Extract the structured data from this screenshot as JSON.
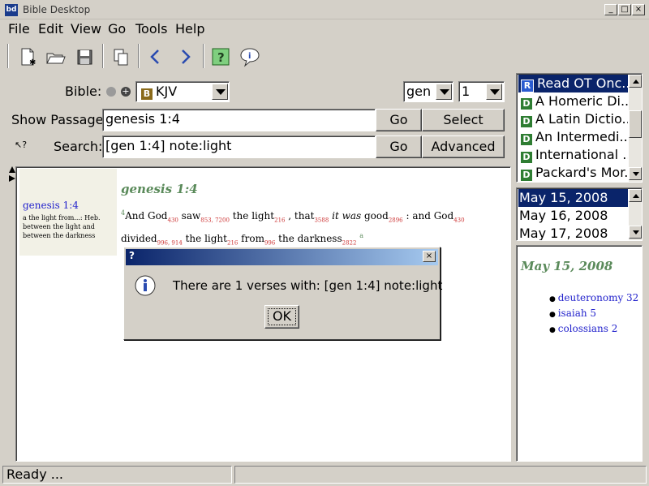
{
  "window": {
    "title": "Bible Desktop",
    "app_icon": "bd",
    "min_glyph": "_",
    "max_glyph": "□",
    "close_glyph": "×"
  },
  "menu": {
    "items": [
      "File",
      "Edit",
      "View",
      "Go",
      "Tools",
      "Help"
    ]
  },
  "toolbar": {
    "icons": [
      "new-window-icon",
      "open-icon",
      "save-icon",
      "copy-icon",
      "back-icon",
      "forward-icon",
      "help-icon",
      "about-icon"
    ]
  },
  "controls": {
    "bible_label": "Bible:",
    "bible_value": "KJV",
    "bible_badge": "B",
    "book_value": "gen",
    "chapter_value": "1",
    "passage_label": "Show Passage:",
    "passage_value": "genesis 1:4",
    "go1": "Go",
    "select": "Select",
    "search_label": "Search:",
    "search_value": "[gen 1:4] note:light",
    "go2": "Go",
    "advanced": "Advanced"
  },
  "note": {
    "ref": "genesis 1:4",
    "line1": "a the light from...: Heb.",
    "line2": "between the light and",
    "line3": "between the darkness"
  },
  "passage": {
    "heading": "genesis 1:4",
    "verse_marker": "4",
    "note_marker": "a",
    "words": [
      {
        "w": "And God",
        "n": "430"
      },
      {
        "w": "saw",
        "n": "853, 7200"
      },
      {
        "w": "the light",
        "n": "216"
      },
      {
        "w": ", that",
        "n": "3588"
      },
      {
        "w": "it was",
        "n": "",
        "italic": true
      },
      {
        "w": "good",
        "n": "2896"
      },
      {
        "w": ": and God",
        "n": "430"
      },
      {
        "w": "divided",
        "n": "996, 914"
      },
      {
        "w": "the light",
        "n": "216"
      },
      {
        "w": "from",
        "n": "996"
      },
      {
        "w": "the darkness",
        "n": "2822"
      }
    ]
  },
  "books": {
    "items": [
      {
        "badge": "R",
        "label": "Read OT Onc...",
        "selected": true
      },
      {
        "badge": "D",
        "label": "A Homeric Di..."
      },
      {
        "badge": "D",
        "label": "A Latin Dictio..."
      },
      {
        "badge": "D",
        "label": "An Intermedi..."
      },
      {
        "badge": "D",
        "label": "International ..."
      },
      {
        "badge": "D",
        "label": "Packard's Mor..."
      }
    ]
  },
  "dates": {
    "items": [
      {
        "label": "May 15, 2008",
        "selected": true
      },
      {
        "label": "May 16, 2008"
      },
      {
        "label": "May 17, 2008"
      }
    ]
  },
  "daily": {
    "heading": "May 15, 2008",
    "refs": [
      "deuteronomy 32",
      "isaiah 5",
      "colossians 2"
    ]
  },
  "dialog": {
    "title": "?",
    "close": "×",
    "message": "There are 1 verses with: [gen 1:4] note:light",
    "ok": "OK"
  },
  "status": {
    "text": "Ready ..."
  },
  "colors": {
    "selection": "#0a246a",
    "link": "#2222cc",
    "heading_green": "#5a8a5a",
    "strong_red": "#cc3333",
    "panel_bg": "#d4d0c8"
  }
}
